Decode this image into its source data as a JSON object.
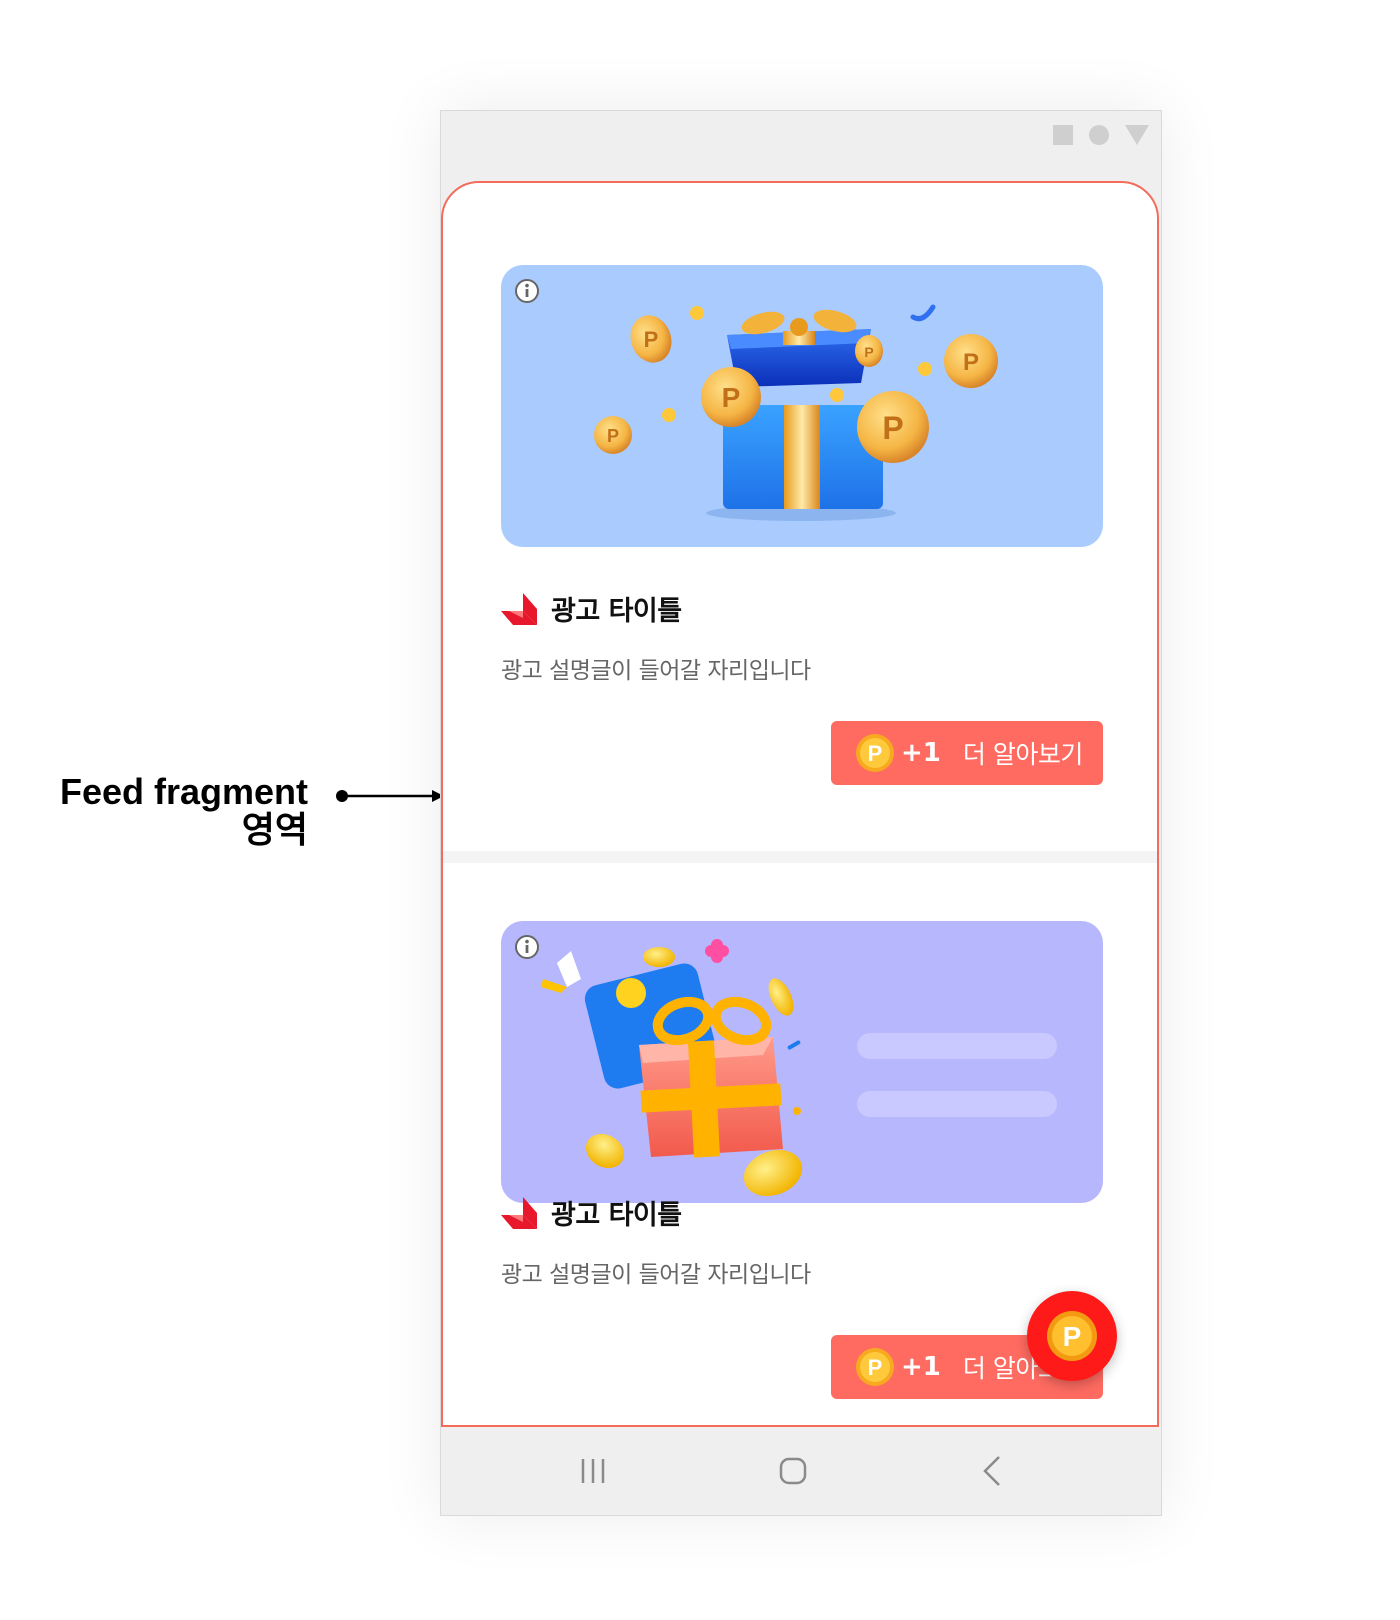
{
  "annotation": {
    "line1": "Feed fragment",
    "line2": "영역"
  },
  "feed": {
    "cards": [
      {
        "title": "광고 타이틀",
        "description": "광고 설명글이 들어갈 자리입니다",
        "cta_points": "+1",
        "cta_label": "더 알아보기",
        "coin_letter": "P",
        "banner_color": "#a9cbfd"
      },
      {
        "title": "광고 타이틀",
        "description": "광고 설명글이 들어갈 자리입니다",
        "cta_points": "+1",
        "cta_label": "더 알아보기",
        "coin_letter": "P",
        "banner_color": "#b7b7fd"
      }
    ]
  },
  "fab": {
    "coin_letter": "P"
  },
  "colors": {
    "accent": "#ff6b61",
    "fab": "#ff1a1a",
    "feed_border": "#f26b5b"
  },
  "icons": [
    "info-icon",
    "brand-logo-icon",
    "point-coin-icon",
    "recent-apps-icon",
    "home-icon",
    "back-icon",
    "status-square-icon",
    "status-circle-icon",
    "status-triangle-icon"
  ]
}
